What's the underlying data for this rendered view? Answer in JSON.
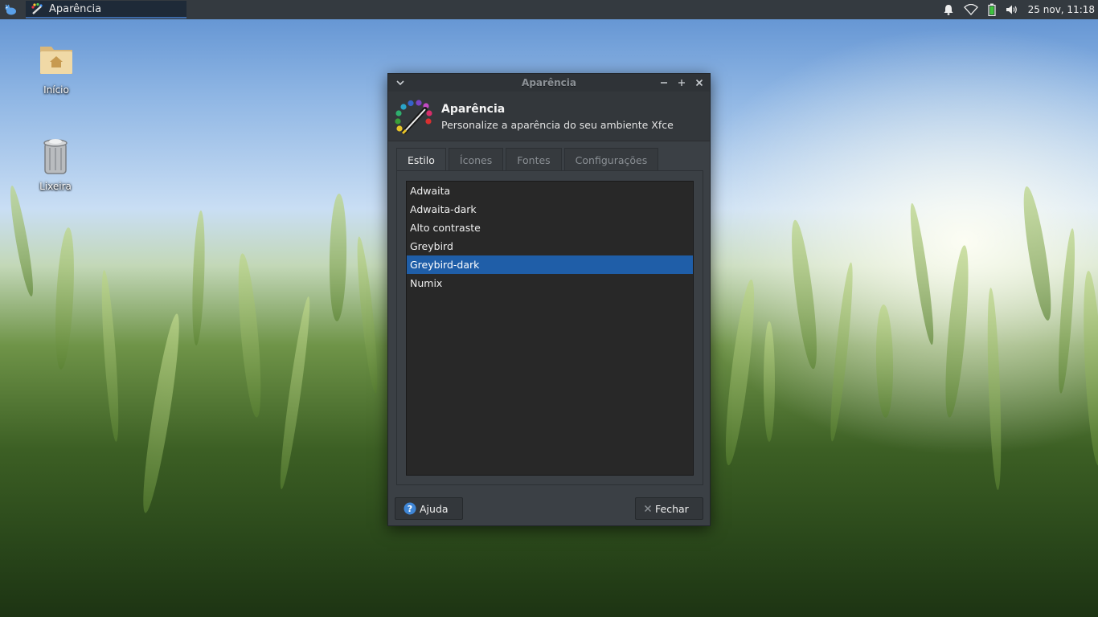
{
  "panel": {
    "task_title": "Aparência",
    "clock": "25 nov, 11:18"
  },
  "desktop": {
    "icons": [
      {
        "label": "Início"
      },
      {
        "label": "Lixeira"
      }
    ]
  },
  "window": {
    "title": "Aparência",
    "header_title": "Aparência",
    "header_subtitle": "Personalize a aparência do seu ambiente Xfce",
    "tabs": [
      {
        "label": "Estilo"
      },
      {
        "label": "Ícones"
      },
      {
        "label": "Fontes"
      },
      {
        "label": "Configurações"
      }
    ],
    "styles": [
      {
        "label": "Adwaita"
      },
      {
        "label": "Adwaita-dark"
      },
      {
        "label": "Alto contraste"
      },
      {
        "label": "Greybird"
      },
      {
        "label": "Greybird-dark"
      },
      {
        "label": "Numix"
      }
    ],
    "selected_style": "Greybird-dark",
    "help_label": "Ajuda",
    "close_label": "Fechar"
  },
  "colors": {
    "selection": "#1f5ea8",
    "panel": "#343a40",
    "window_bg": "#3b4045"
  }
}
